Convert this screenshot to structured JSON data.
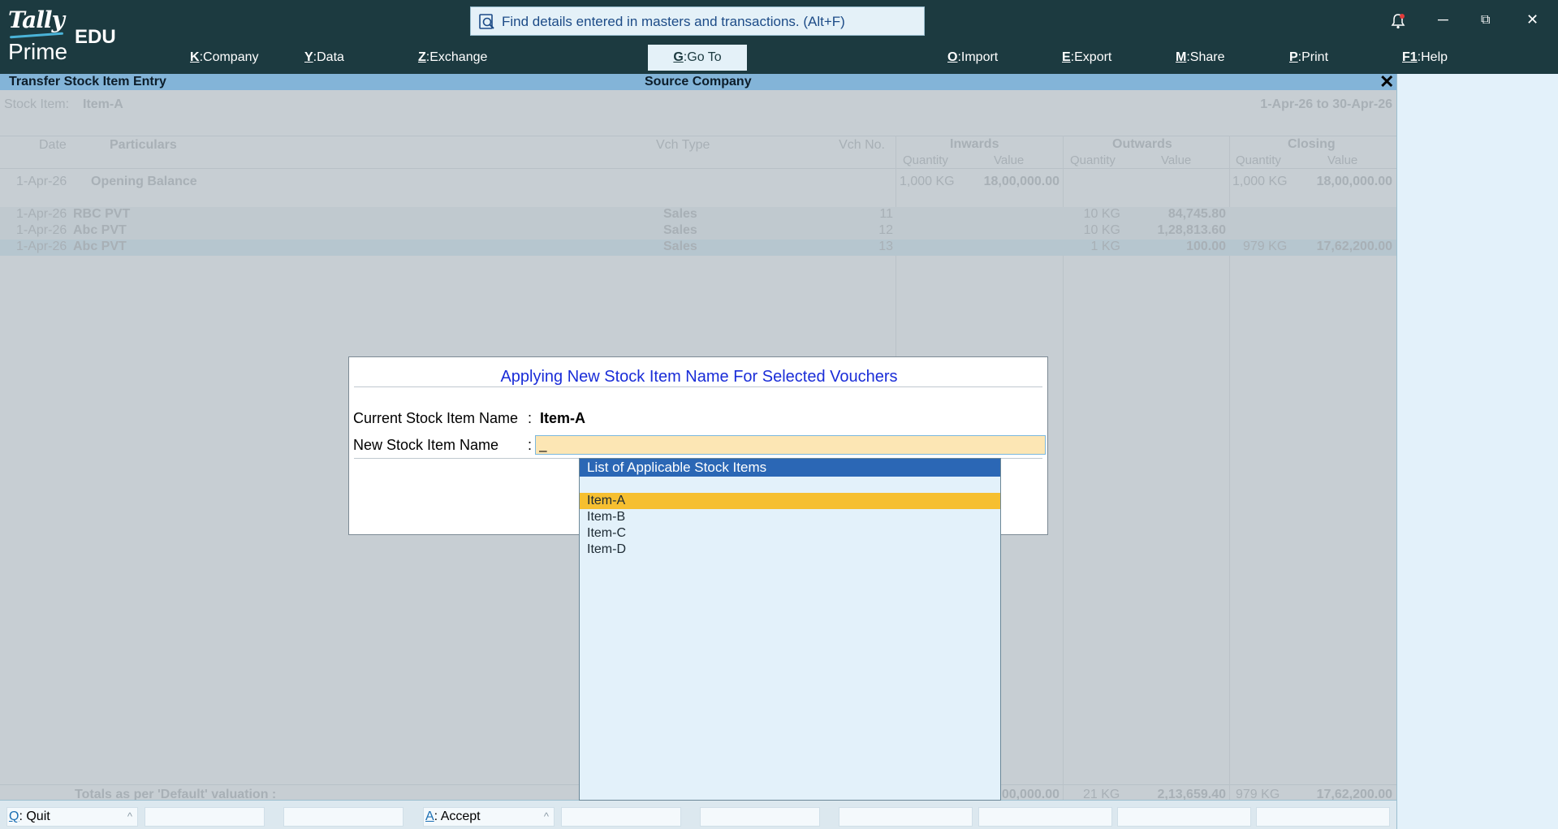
{
  "app": {
    "logo_line1": "Tally",
    "logo_line2": "Prime",
    "edition": "EDU",
    "search_placeholder": "Find details entered in masters and transactions. (Alt+F)"
  },
  "menu": [
    {
      "key": "K",
      "label": "Company"
    },
    {
      "key": "Y",
      "label": "Data"
    },
    {
      "key": "Z",
      "label": "Exchange"
    },
    {
      "key": "G",
      "label": "Go To"
    },
    {
      "key": "O",
      "label": "Import"
    },
    {
      "key": "E",
      "label": "Export"
    },
    {
      "key": "M",
      "label": "Share"
    },
    {
      "key": "P",
      "label": "Print"
    },
    {
      "key": "F1",
      "label": "Help"
    }
  ],
  "window_controls": {
    "notification_icon": "bell-icon",
    "minimize": "─",
    "restore": "⧉",
    "close": "✕"
  },
  "screen": {
    "title": "Transfer Stock Item Entry",
    "center_title": "Source Company",
    "close_glyph": "✕"
  },
  "report": {
    "stock_item_label": "Stock Item:",
    "stock_item_value": "Item-A",
    "period": "1-Apr-26 to 30-Apr-26",
    "headers": {
      "date": "Date",
      "particulars": "Particulars",
      "vch_type": "Vch Type",
      "vch_no": "Vch No.",
      "inwards": "Inwards",
      "outwards": "Outwards",
      "closing": "Closing",
      "quantity": "Quantity",
      "value": "Value"
    },
    "opening": {
      "date": "1-Apr-26",
      "label": "Opening Balance",
      "in_qty": "1,000 KG",
      "in_val": "18,00,000.00",
      "cl_qty": "1,000 KG",
      "cl_val": "18,00,000.00"
    },
    "rows": [
      {
        "date": "1-Apr-26",
        "party": "RBC PVT",
        "vch_type": "Sales",
        "vch_no": "11",
        "out_qty": "10 KG",
        "out_val": "84,745.80",
        "cl_qty": "",
        "cl_val": ""
      },
      {
        "date": "1-Apr-26",
        "party": "Abc PVT",
        "vch_type": "Sales",
        "vch_no": "12",
        "out_qty": "10 KG",
        "out_val": "1,28,813.60",
        "cl_qty": "",
        "cl_val": ""
      },
      {
        "date": "1-Apr-26",
        "party": "Abc PVT",
        "vch_type": "Sales",
        "vch_no": "13",
        "out_qty": "1 KG",
        "out_val": "100.00",
        "cl_qty": "979 KG",
        "cl_val": "17,62,200.00"
      }
    ],
    "totals": {
      "label": "Totals as per 'Default' valuation :",
      "in_val": "00,000.00",
      "out_qty": "21 KG",
      "out_val": "2,13,659.40",
      "cl_qty": "979 KG",
      "cl_val": "17,62,200.00"
    }
  },
  "dialog": {
    "title": "Applying New Stock Item Name For Selected Vouchers",
    "current_label": "Current Stock Item Name",
    "current_value": "Item-A",
    "new_label": "New Stock Item Name",
    "new_value": "_",
    "colon": ":"
  },
  "list": {
    "header": "List of Applicable Stock Items",
    "items": [
      "Item-A",
      "Item-B",
      "Item-C",
      "Item-D"
    ],
    "selected_index": 0
  },
  "footer": [
    {
      "key": "Q",
      "label": "Quit"
    },
    {
      "key": "A",
      "label": "Accept"
    }
  ],
  "colors": {
    "topbar": "#1c3a40",
    "title_strip": "#83b4d8",
    "dialog_title": "#1a2dd8",
    "list_header": "#2b67b5",
    "list_selection": "#f6bf30",
    "input_bg": "#fce6b4"
  }
}
